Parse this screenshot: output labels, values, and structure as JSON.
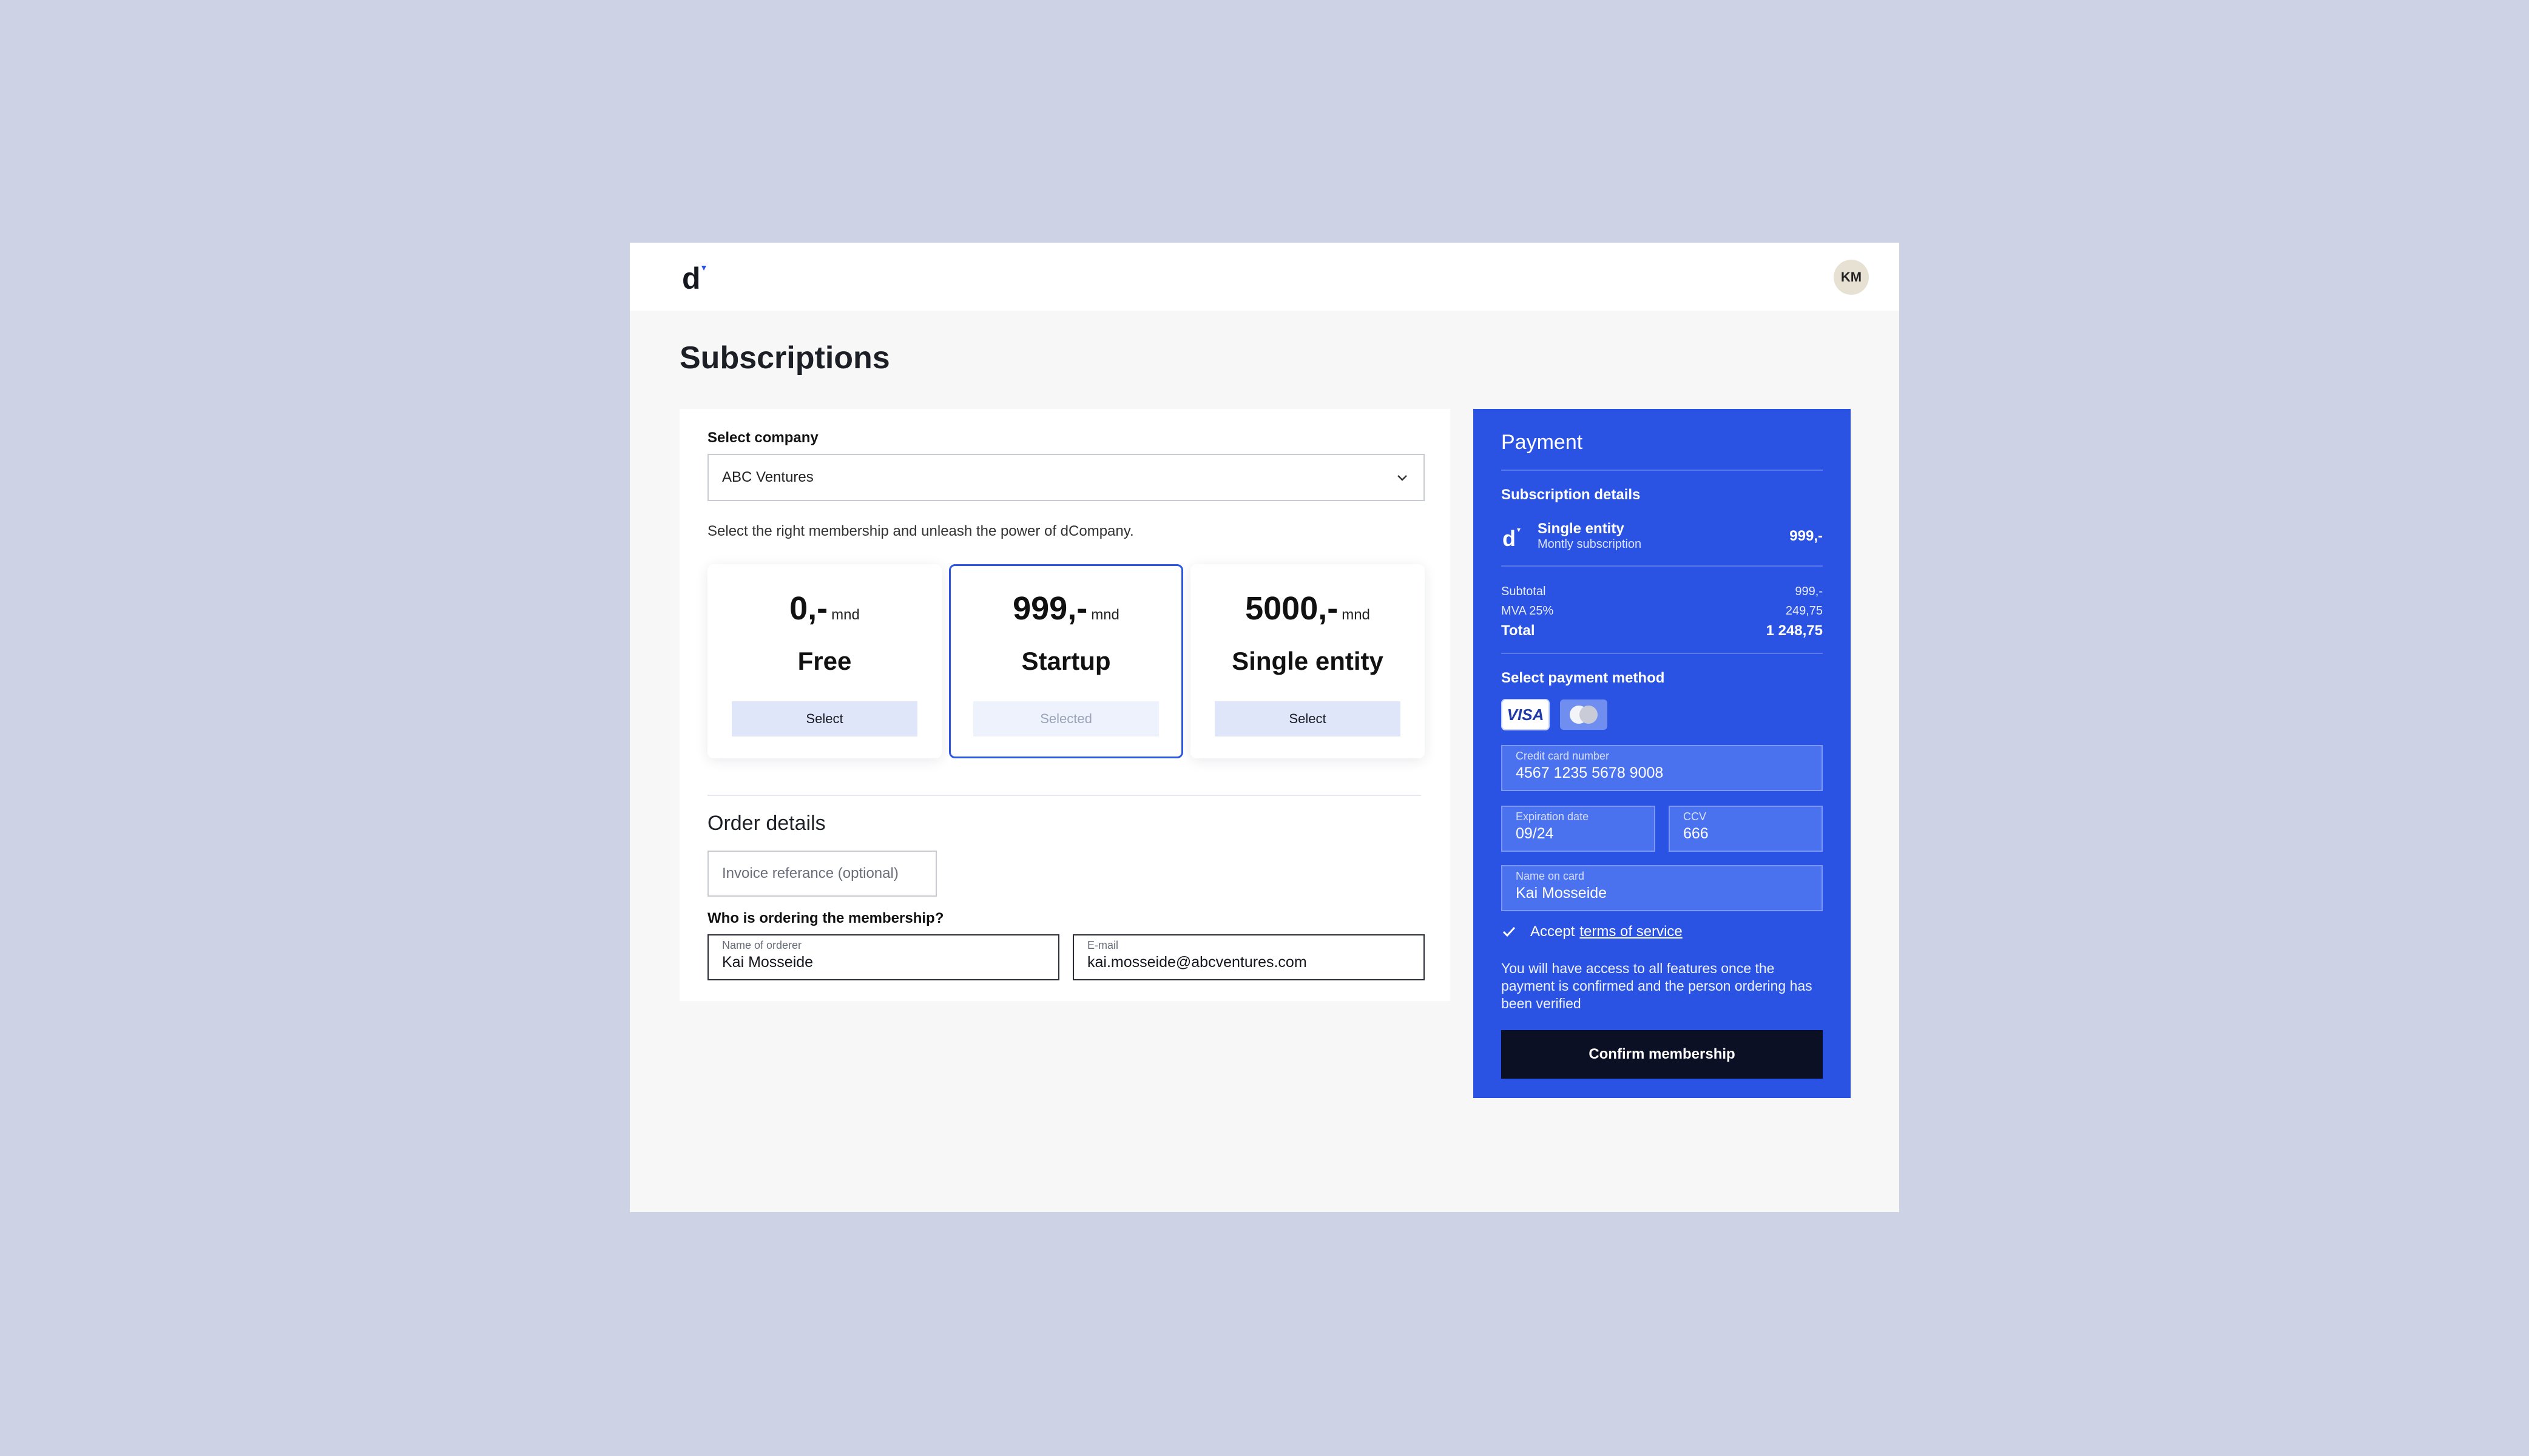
{
  "header": {
    "logo": "d-logo",
    "avatar_initials": "KM"
  },
  "page": {
    "title": "Subscriptions"
  },
  "company": {
    "label": "Select company",
    "value": "ABC Ventures"
  },
  "intro": "Select the right membership and unleash the power of dCompany.",
  "plans": [
    {
      "price": "0,-",
      "unit": "mnd",
      "name": "Free",
      "button": "Select",
      "selected": false
    },
    {
      "price": "999,-",
      "unit": "mnd",
      "name": "Startup",
      "button": "Selected",
      "selected": true
    },
    {
      "price": "5000,-",
      "unit": "mnd",
      "name": "Single entity",
      "button": "Select",
      "selected": false
    }
  ],
  "order": {
    "title": "Order details",
    "invoice_placeholder": "Invoice referance (optional)",
    "who_label": "Who is ordering the membership?",
    "name_label": "Name of orderer",
    "name_value": "Kai Mosseide",
    "email_label": "E-mail",
    "email_value": "kai.mosseide@abcventures.com"
  },
  "payment": {
    "title": "Payment",
    "details_label": "Subscription details",
    "item_name": "Single entity",
    "item_desc": "Montly subscription",
    "item_price": "999,-",
    "subtotal_label": "Subtotal",
    "subtotal_value": "999,-",
    "vat_label": "MVA 25%",
    "vat_value": "249,75",
    "total_label": "Total",
    "total_value": "1 248,75",
    "method_label": "Select payment method",
    "methods": [
      "visa-icon",
      "mastercard-icon"
    ],
    "card_number_label": "Credit card number",
    "card_number_value": "4567 1235 5678 9008",
    "expiry_label": "Expiration date",
    "expiry_value": "09/24",
    "ccv_label": "CCV",
    "ccv_value": "666",
    "name_label": "Name on card",
    "name_value": "Kai Mosseide",
    "accept_text": "Accept",
    "terms_link": "terms of service",
    "note": "You will have access to all features once the payment is confirmed and the person ordering has been verified",
    "confirm_button": "Confirm membership"
  },
  "colors": {
    "accent": "#2b53e3",
    "background": "#cdd3e5",
    "dark_button": "#0c1024"
  }
}
